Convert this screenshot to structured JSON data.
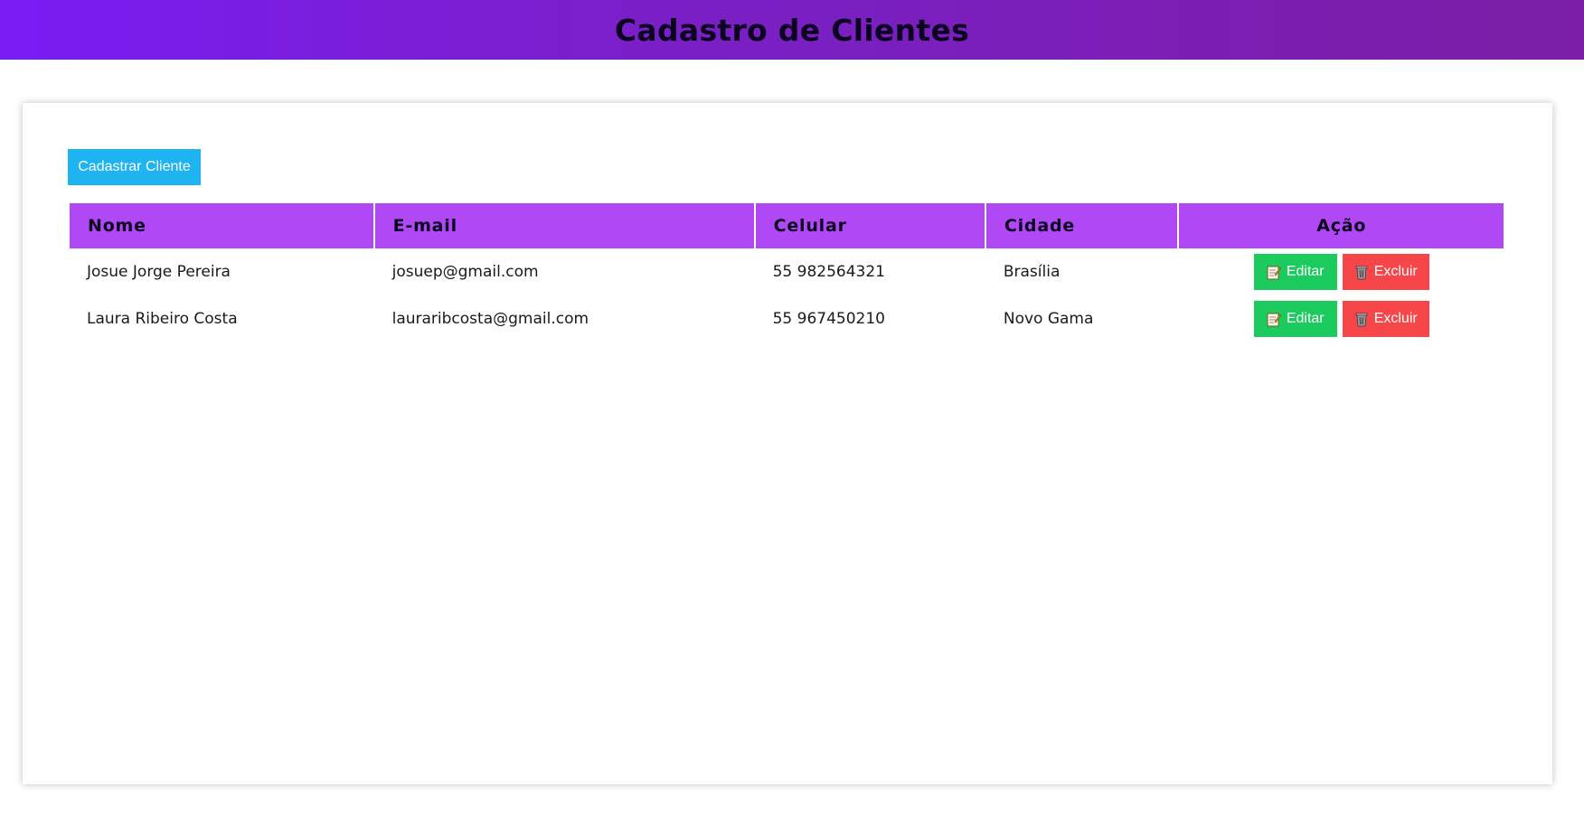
{
  "header": {
    "title": "Cadastro de Clientes",
    "gradient": [
      "#7a1cf4",
      "#7c1fa6"
    ]
  },
  "toolbar": {
    "add_label": "Cadastrar Cliente",
    "add_color": "#1eb4f2"
  },
  "table": {
    "header_color": "#b048f5",
    "columns": [
      "Nome",
      "E-mail",
      "Celular",
      "Cidade",
      "Ação"
    ],
    "rows": [
      {
        "nome": "Josue Jorge Pereira",
        "email": "josuep@gmail.com",
        "celular": "55 982564321",
        "cidade": "Brasília"
      },
      {
        "nome": "Laura Ribeiro Costa",
        "email": "lauraribcosta@gmail.com",
        "celular": "55 967450210",
        "cidade": "Novo Gama"
      }
    ],
    "actions": {
      "edit_label": "Editar",
      "edit_icon": "memo-icon",
      "edit_color": "#1ccb5e",
      "delete_label": "Excluir",
      "delete_icon": "trash-icon",
      "delete_color": "#f7464a"
    }
  }
}
